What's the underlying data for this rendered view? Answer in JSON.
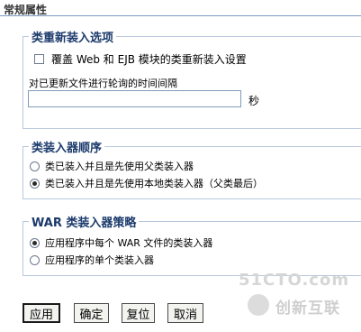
{
  "page": {
    "title": "常规属性"
  },
  "class_reload": {
    "legend": "类重新装入选项",
    "override_label": "覆盖 Web 和 EJB 模块的类重新装入设置",
    "override_checked": false,
    "poll_label": "对已更新文件进行轮询的时间间隔",
    "poll_value": "",
    "poll_unit": "秒"
  },
  "classloader_order": {
    "legend": "类装入器顺序",
    "options": [
      {
        "label": "类已装入并且是先使用父类装入器",
        "selected": false
      },
      {
        "label": "类已装入并且是先使用本地类装入器（父类最后）",
        "selected": true
      }
    ]
  },
  "war_policy": {
    "legend": "WAR 类装入器策略",
    "options": [
      {
        "label": "应用程序中每个 WAR 文件的类装入器",
        "selected": true
      },
      {
        "label": "应用程序的单个类装入器",
        "selected": false
      }
    ]
  },
  "buttons": {
    "apply": "应用",
    "ok": "确定",
    "reset": "复位",
    "cancel": "取消"
  },
  "watermark": {
    "site": "51CTO.com",
    "brand": "创新互联"
  }
}
